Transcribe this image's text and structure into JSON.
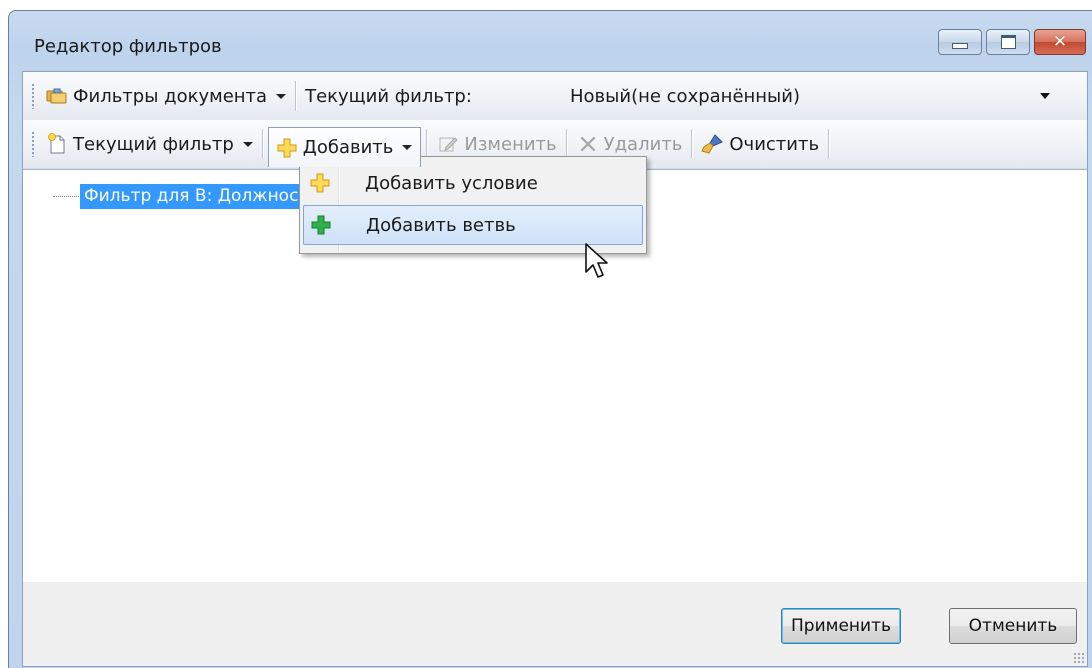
{
  "window": {
    "title": "Редактор фильтров",
    "controls": [
      "minimize",
      "maximize",
      "close"
    ]
  },
  "toolbar1": {
    "filters_menu_label": "Фильтры документа",
    "current_filter_label": "Текущий фильтр:",
    "current_filter_value": "Новый(не сохранённый)"
  },
  "toolbar2": {
    "current_filter_menu_label": "Текущий фильтр",
    "add_label": "Добавить",
    "edit_label": "Изменить",
    "delete_label": "Удалить",
    "clear_label": "Очистить"
  },
  "tree": {
    "nodes": [
      {
        "label": "Фильтр для В: Должнос",
        "selected": true
      }
    ]
  },
  "add_menu": {
    "items": [
      {
        "label": "Добавить условие",
        "icon": "yellow-plus-icon"
      },
      {
        "label": "Добавить ветвь",
        "icon": "green-plus-icon",
        "highlighted": true
      }
    ]
  },
  "footer": {
    "apply_label": "Применить",
    "cancel_label": "Отменить"
  },
  "colors": {
    "selection": "#3399ff",
    "menu_highlight": "#cfe2f8",
    "title_bg": "#c4d8ee",
    "close_button": "#c24a33"
  }
}
